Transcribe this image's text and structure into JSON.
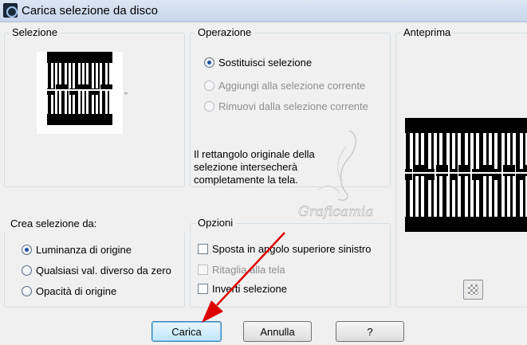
{
  "window": {
    "title": "Carica selezione da disco"
  },
  "selection_group": {
    "label": "Selezione"
  },
  "operation_group": {
    "label": "Operazione",
    "options": [
      {
        "label": "Sostituisci selezione",
        "checked": true,
        "enabled": true
      },
      {
        "label": "Aggiungi alla selezione corrente",
        "checked": false,
        "enabled": false
      },
      {
        "label": "Rimuovi dalla selezione corrente",
        "checked": false,
        "enabled": false
      }
    ],
    "description": "Il rettangolo originale della selezione intersecherà completamente la tela."
  },
  "preview_group": {
    "label": "Anteprima",
    "checker_button_icon": "checkerboard-icon"
  },
  "create_from": {
    "label": "Crea selezione da:",
    "options": [
      {
        "label": "Luminanza di origine",
        "checked": true
      },
      {
        "label": "Qualsiasi val. diverso da zero",
        "checked": false
      },
      {
        "label": "Opacità di origine",
        "checked": false
      }
    ]
  },
  "options_group": {
    "label": "Opzioni",
    "items": [
      {
        "label": "Sposta in angolo superiore sinistro",
        "checked": false,
        "enabled": true
      },
      {
        "label": "Ritaglia alla tela",
        "checked": false,
        "enabled": false
      },
      {
        "label": "Inverti selezione",
        "checked": false,
        "enabled": true
      }
    ]
  },
  "buttons": {
    "load": "Carica",
    "cancel": "Annulla",
    "help": "?"
  },
  "watermark": {
    "text": "Graficamia"
  },
  "colors": {
    "arrow": "#dd0000",
    "accent": "#1c4fa0",
    "group_border": "#d5dfe5"
  }
}
